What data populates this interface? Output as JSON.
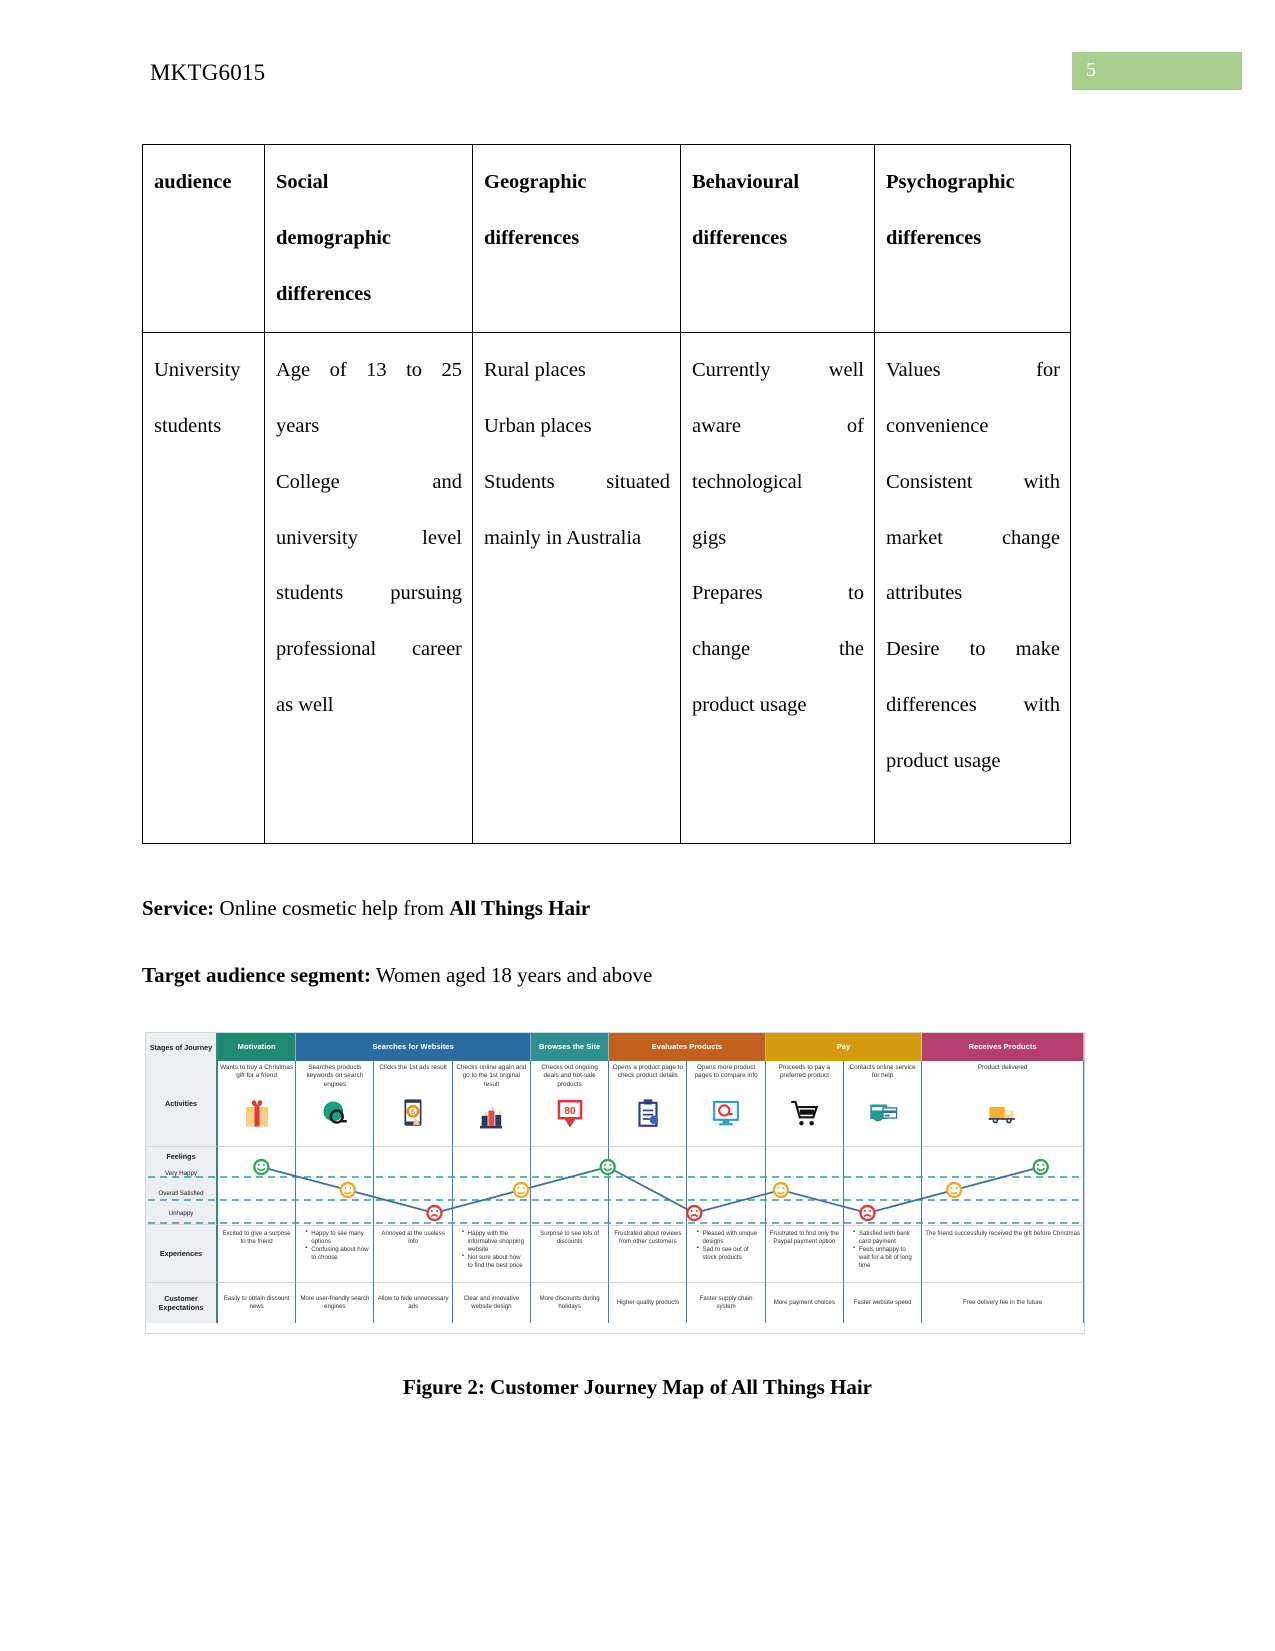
{
  "header": {
    "running_title": "MKTG6015",
    "page_number": "5",
    "badge_color": "#a9cf8f"
  },
  "segmentation_table": {
    "columns": [
      "audience",
      "Social demographic differences",
      "Geographic differences",
      "Behavioural differences",
      "Psychographic differences"
    ],
    "headers": {
      "audience": "audience",
      "social_l1": "Social",
      "social_l2": "demographic",
      "social_l3": "differences",
      "geo_l1": "Geographic",
      "geo_l2": "differences",
      "behav_l1": "Behavioural",
      "behav_l2": "differences",
      "psycho_l1": "Psychographic",
      "psycho_l2": "differences"
    },
    "row": {
      "audience_l1": "University",
      "audience_l2": "students",
      "social_l1": "Age of 13 to 25",
      "social_l2": "years",
      "social_l3": "College and",
      "social_l4": "university level",
      "social_l5": "students pursuing",
      "social_l6": "professional career",
      "social_l7": "as well",
      "geo_l1": "Rural places",
      "geo_l2": "Urban places",
      "geo_l3": "Students situated",
      "geo_l4": "mainly in Australia",
      "behav_l1": "Currently well",
      "behav_l2": "aware of",
      "behav_l3": "technological",
      "behav_l4": "gigs",
      "behav_l5": "Prepares to",
      "behav_l6": "change the",
      "behav_l7": "product usage",
      "psycho_l1": "Values for",
      "psycho_l2": "convenience",
      "psycho_l3": "Consistent with",
      "psycho_l4": "market change",
      "psycho_l5": "attributes",
      "psycho_l6": "Desire to make",
      "psycho_l7": "differences with",
      "psycho_l8": "product usage"
    }
  },
  "paragraphs": {
    "service_label": "Service:",
    "service_text": " Online cosmetic help from ",
    "service_brand": "All Things Hair",
    "target_label": "Target audience segment:",
    "target_text": " Women aged 18 years and above"
  },
  "figure": {
    "caption": "Figure 2: Customer Journey Map of All Things Hair",
    "row_labels": {
      "stages": "Stages of Journey",
      "activities": "Activities",
      "feelings": "Feelings",
      "experiences": "Experiences",
      "expectations": "Customer Expectations"
    },
    "feeling_levels": [
      "Very Happy",
      "Overall Satisfied",
      "Unhappy"
    ],
    "stages": [
      {
        "label": "Motivation",
        "color": "#1f8a70",
        "span": 1
      },
      {
        "label": "Searches for Websites",
        "color": "#2b6ca3",
        "span": 3
      },
      {
        "label": "Browses the Site",
        "color": "#2f8f90",
        "span": 1
      },
      {
        "label": "Evaluates Products",
        "color": "#c2601f",
        "span": 2
      },
      {
        "label": "Pay",
        "color": "#d49a10",
        "span": 2
      },
      {
        "label": "Receives Products",
        "color": "#b43f6d",
        "span": 1
      }
    ],
    "columns": [
      {
        "activity": "Wants to buy a Christmas gift for a friend",
        "icon": "gift-icon",
        "feeling": "Very Happy",
        "experience": "Excited to give a surprise to the friend",
        "experience_bullets": [],
        "expectation": "Easily to obtain discount news"
      },
      {
        "activity": "Searches products keywords on search engines",
        "icon": "search-globe-icon",
        "feeling": "Overall Satisfied",
        "experience": "",
        "experience_bullets": [
          "Happy to see many options",
          "Confusing about how to choose"
        ],
        "expectation": "More user-friendly search engines"
      },
      {
        "activity": "Clicks the 1st ads result",
        "icon": "mobile-ad-icon",
        "feeling": "Unhappy",
        "experience": "Annoyed at the useless info",
        "experience_bullets": [],
        "expectation": "Allow to hide unnecessary ads"
      },
      {
        "activity": "Checks online again and go to the 1st original result",
        "icon": "ranking-chart-icon",
        "feeling": "Overall Satisfied",
        "experience": "",
        "experience_bullets": [
          "Happy with the informative shopping website",
          "Not sure about how to find the best price"
        ],
        "expectation": "Clear and innovative website design"
      },
      {
        "activity": "Checks out ongoing deals and hot-sale products",
        "icon": "discount-80-icon",
        "feeling": "Very Happy",
        "experience": "Surprise to see lots of discounts",
        "experience_bullets": [],
        "expectation": "More discounts during holidays"
      },
      {
        "activity": "Opens a product page to check product details",
        "icon": "clipboard-icon",
        "feeling": "Unhappy",
        "experience": "Frustrated about reviews from other customers",
        "experience_bullets": [],
        "expectation": "Higher quality products"
      },
      {
        "activity": "Opens more product pages to compare info",
        "icon": "monitor-search-icon",
        "feeling": "Overall Satisfied",
        "experience": "",
        "experience_bullets": [
          "Pleased with unique designs",
          "Sad to see out of stock products"
        ],
        "expectation": "Faster supply chain system"
      },
      {
        "activity": "Proceeds to pay a preferred product",
        "icon": "shopping-cart-icon",
        "feeling": "Unhappy",
        "experience": "Frustrated to find only the Paypal payment option",
        "experience_bullets": [],
        "expectation": "More payment choices"
      },
      {
        "activity": "Contacts online service for help",
        "icon": "payment-card-icon",
        "feeling": "Overall Satisfied",
        "experience": "",
        "experience_bullets": [
          "Satisfied with bank card payment",
          "Feels unhappy to wait for a bit of long time"
        ],
        "expectation": "Faster website speed"
      },
      {
        "activity": "Product delivered",
        "icon": "delivery-truck-icon",
        "feeling": "Very Happy",
        "experience": "The friend successfully received the gift before Christmas",
        "experience_bullets": [],
        "expectation": "Free delivery fee in the future"
      }
    ]
  }
}
